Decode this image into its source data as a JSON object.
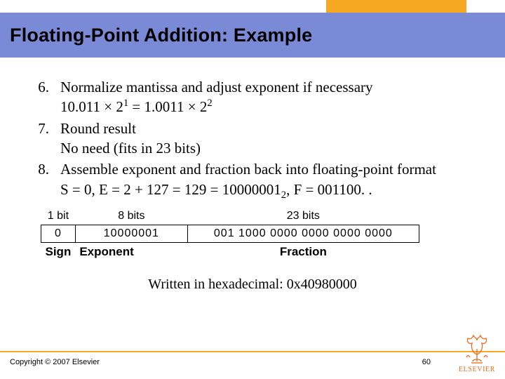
{
  "title": "Floating-Point Addition: Example",
  "steps": [
    {
      "n": "6.",
      "line1": "Normalize mantissa and adjust exponent if necessary",
      "expr_a": "10.011 × 2",
      "exp_a": "1",
      "eq": " = 1.0011 × 2",
      "exp_b": "2"
    },
    {
      "n": "7.",
      "line1": "Round result",
      "line2": "No need (fits in 23 bits)"
    },
    {
      "n": "8.",
      "line1": "Assemble exponent and fraction back into floating-point format",
      "s_eq": "S = 0, E = 2 + 127 = 129 = 10000001",
      "s_sub": "2",
      "f_eq": ", F = 001100. ."
    }
  ],
  "diagram": {
    "widths": {
      "sign": "1 bit",
      "exponent": "8 bits",
      "fraction": "23 bits"
    },
    "values": {
      "sign": "0",
      "exponent": "10000001",
      "fraction": "001 1000 0000 0000 0000 0000"
    },
    "labels": {
      "sign": "Sign",
      "exponent": "Exponent",
      "fraction": "Fraction"
    }
  },
  "hex_line": "Written in hexadecimal: 0x40980000",
  "footer": {
    "copyright": "Copyright © 2007 Elsevier",
    "page": "60",
    "logo": "ELSEVIER"
  }
}
